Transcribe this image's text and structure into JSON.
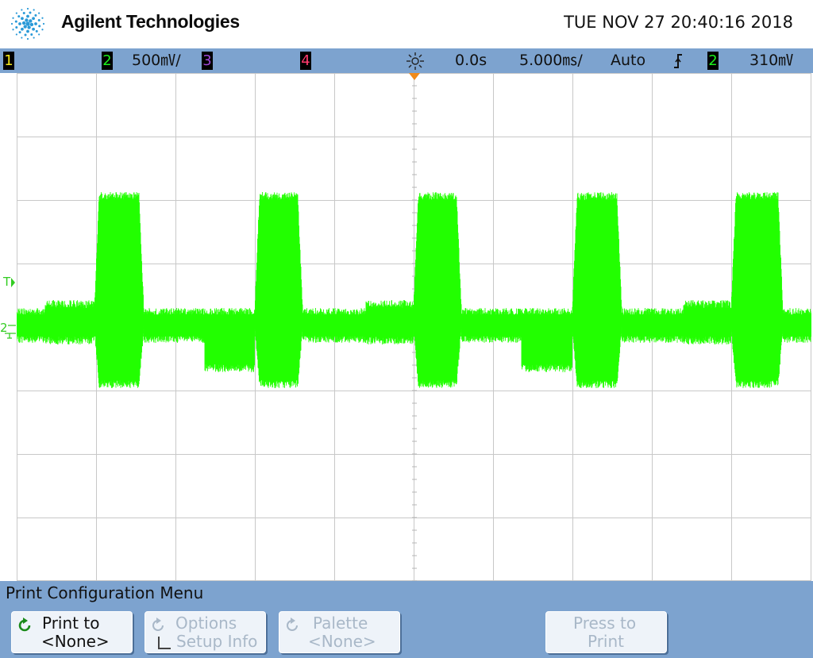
{
  "header": {
    "brand": "Agilent Technologies",
    "datetime": "TUE NOV 27 20:40:16 2018"
  },
  "statusbar": {
    "ch1": "1",
    "ch2": "2",
    "ch2_scale": "500㎷/",
    "ch3": "3",
    "ch4": "4",
    "time_delay": "0.0s",
    "time_scale": "5.000㎳/",
    "trigger_mode": "Auto",
    "trigger_slope_icon": "rising-edge-icon",
    "trigger_source": "2",
    "trigger_level": "310㎷",
    "colors": {
      "ch1": "#f4e81c",
      "ch2": "#1cf01c",
      "ch3": "#a048d8",
      "ch4": "#ff3b6e"
    }
  },
  "waveform": {
    "channel": "2",
    "color": "#22ff00",
    "trigger_marker": "T",
    "ground_marker": "2"
  },
  "menu": {
    "title": "Print Configuration Menu",
    "softkeys": [
      {
        "line1": "Print to",
        "line2": "<None>",
        "enabled": true,
        "icon": "cycle-arrow-icon"
      },
      {
        "line1": "Options",
        "line2": "Setup Info",
        "enabled": false,
        "icon": "cycle-arrow-icon"
      },
      {
        "line1": "Palette",
        "line2": "<None>",
        "enabled": false,
        "icon": "cycle-arrow-icon"
      },
      {
        "line1": "Press to",
        "line2": "Print",
        "enabled": false
      }
    ]
  }
}
